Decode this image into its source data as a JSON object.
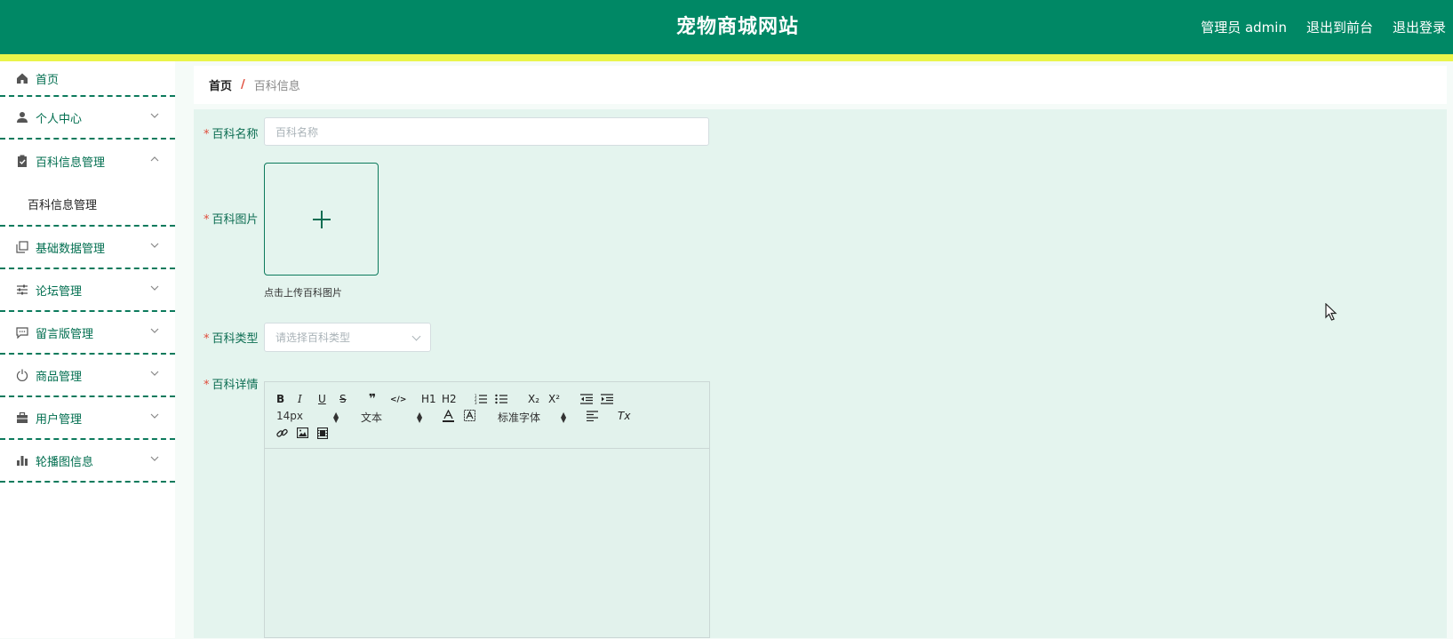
{
  "header": {
    "title": "宠物商城网站",
    "links": [
      "管理员 admin",
      "退出到前台",
      "退出登录"
    ]
  },
  "sidebar": {
    "items": [
      {
        "label": "首页",
        "icon": "home-icon"
      },
      {
        "label": "个人中心",
        "icon": "user-icon"
      },
      {
        "label": "百科信息管理",
        "icon": "clipboard-icon",
        "expanded": true,
        "sub": "百科信息管理"
      },
      {
        "label": "基础数据管理",
        "icon": "copy-icon"
      },
      {
        "label": "论坛管理",
        "icon": "sliders-icon"
      },
      {
        "label": "留言版管理",
        "icon": "chat-icon"
      },
      {
        "label": "商品管理",
        "icon": "power-icon"
      },
      {
        "label": "用户管理",
        "icon": "briefcase-icon"
      },
      {
        "label": "轮播图信息",
        "icon": "bar-chart-icon"
      }
    ]
  },
  "breadcrumb": {
    "home": "首页",
    "separator": "/",
    "current": "百科信息"
  },
  "form": {
    "name_label": "百科名称",
    "name_placeholder": "百科名称",
    "image_label": "百科图片",
    "image_hint": "点击上传百科图片",
    "type_label": "百科类型",
    "type_placeholder": "请选择百科类型",
    "detail_label": "百科详情"
  },
  "editor": {
    "font_size": "14px",
    "header_select": "文本",
    "font_family": "标准字体",
    "buttons": [
      "B",
      "I",
      "U",
      "S",
      "❞",
      "</>",
      "H1",
      "H2",
      "ordered-list",
      "bullet-list",
      "X₂",
      "X²",
      "outdent",
      "indent",
      "font-color",
      "background-color",
      "align",
      "Tx",
      "link",
      "image",
      "video"
    ]
  },
  "colors": {
    "primary": "#008865",
    "accent_stripe": "#eaf44a",
    "form_bg": "#e4f4ee",
    "required": "#e04b3a"
  }
}
